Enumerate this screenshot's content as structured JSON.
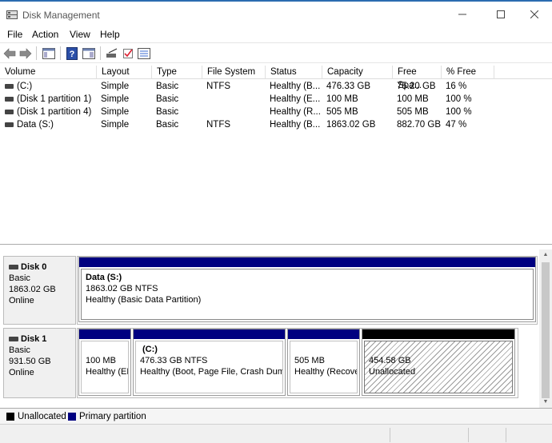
{
  "window": {
    "title": "Disk Management",
    "minimize": "—",
    "maximize": "☐",
    "close": "✕"
  },
  "menu": [
    "File",
    "Action",
    "View",
    "Help"
  ],
  "colors": {
    "primary_partition": "#000080",
    "unallocated": "#000000",
    "title_accent": "#2b6cb0"
  },
  "volume_list": {
    "columns": [
      "Volume",
      "Layout",
      "Type",
      "File System",
      "Status",
      "Capacity",
      "Free Spa...",
      "% Free"
    ],
    "rows": [
      [
        "(C:)",
        "Simple",
        "Basic",
        "NTFS",
        "Healthy (B...",
        "476.33 GB",
        "75.20 GB",
        "16 %"
      ],
      [
        "(Disk 1 partition 1)",
        "Simple",
        "Basic",
        "",
        "Healthy (E...",
        "100 MB",
        "100 MB",
        "100 %"
      ],
      [
        "(Disk 1 partition 4)",
        "Simple",
        "Basic",
        "",
        "Healthy (R...",
        "505 MB",
        "505 MB",
        "100 %"
      ],
      [
        "Data (S:)",
        "Simple",
        "Basic",
        "NTFS",
        "Healthy (B...",
        "1863.02 GB",
        "882.70 GB",
        "47 %"
      ]
    ]
  },
  "disks": [
    {
      "name": "Disk 0",
      "type": "Basic",
      "size": "1863.02 GB",
      "status": "Online",
      "partitions": [
        {
          "title": "Data  (S:)",
          "line2": "1863.02 GB NTFS",
          "line3": "Healthy (Basic Data Partition)"
        }
      ]
    },
    {
      "name": "Disk 1",
      "type": "Basic",
      "size": "931.50 GB",
      "status": "Online",
      "partitions": [
        {
          "title": "",
          "line2": "100 MB",
          "line3": "Healthy (EF"
        },
        {
          "title": "(C:)",
          "line2": "476.33 GB NTFS",
          "line3": "Healthy (Boot, Page File, Crash Dump"
        },
        {
          "title": "",
          "line2": "505 MB",
          "line3": "Healthy (Recove"
        },
        {
          "title": "",
          "line2": "454.58 GB",
          "line3": "Unallocated"
        }
      ]
    }
  ],
  "legend": {
    "unallocated": "Unallocated",
    "primary": "Primary partition"
  }
}
